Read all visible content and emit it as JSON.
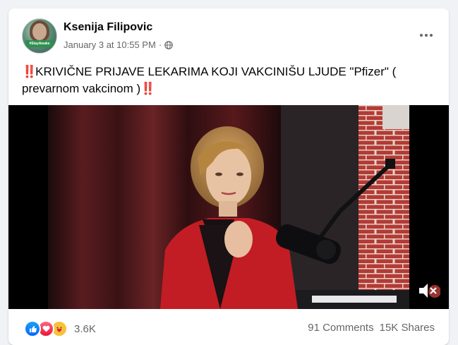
{
  "post": {
    "author": "Ksenija Filipovic",
    "date": "January 3 at 10:55 PM",
    "separator": "·",
    "visibility_icon": "globe-icon",
    "avatar_badge": "#StayAwake",
    "text_prefix_emoji": "‼️",
    "text": "KRIVIČNE PRIJAVE LEKARIMA KOJI VAKCINIŠU LJUDE \"Pfizer\" ( prevarnom vakcinom )",
    "text_suffix_emoji": "‼️"
  },
  "video": {
    "mute_icon": "muted-speaker-icon"
  },
  "footer": {
    "reaction_icons": [
      "like-icon",
      "love-icon",
      "care-icon"
    ],
    "reaction_count": "3.6K",
    "comments": "91 Comments",
    "shares": "15K Shares"
  },
  "colors": {
    "accent_like": "#0866ff",
    "accent_love": "#e61739",
    "accent_care": "#f7c13a",
    "text_secondary": "#65676b"
  }
}
